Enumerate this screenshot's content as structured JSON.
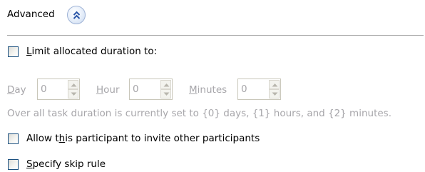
{
  "section": {
    "title": "Advanced",
    "toggle_icon": "double-chevron-up-icon"
  },
  "limit_duration": {
    "label_mnemonic": "L",
    "label_rest": "imit allocated duration to:",
    "checked": false
  },
  "duration": {
    "day": {
      "label_mnemonic": "D",
      "label_rest": "ay",
      "value": "0"
    },
    "hour": {
      "label_mnemonic": "H",
      "label_rest": "our",
      "value": "0"
    },
    "minutes": {
      "label_mnemonic": "M",
      "label_rest": "inutes",
      "value": "0"
    },
    "enabled": false
  },
  "info_text": "Over all task duration is currently set to {0} days, {1} hours, and {2} minutes.",
  "invite": {
    "label_before": "Allow t",
    "label_mnemonic": "h",
    "label_after": "is participant to invite other participants",
    "checked": false
  },
  "skip_rule": {
    "label_mnemonic": "S",
    "label_rest": "pecify skip rule",
    "checked": false
  },
  "colors": {
    "disabled_text": "#a7a6aa",
    "checkbox_border": "#1c5180",
    "divider": "#a8a8a8",
    "chevron": "#2a56a8"
  }
}
